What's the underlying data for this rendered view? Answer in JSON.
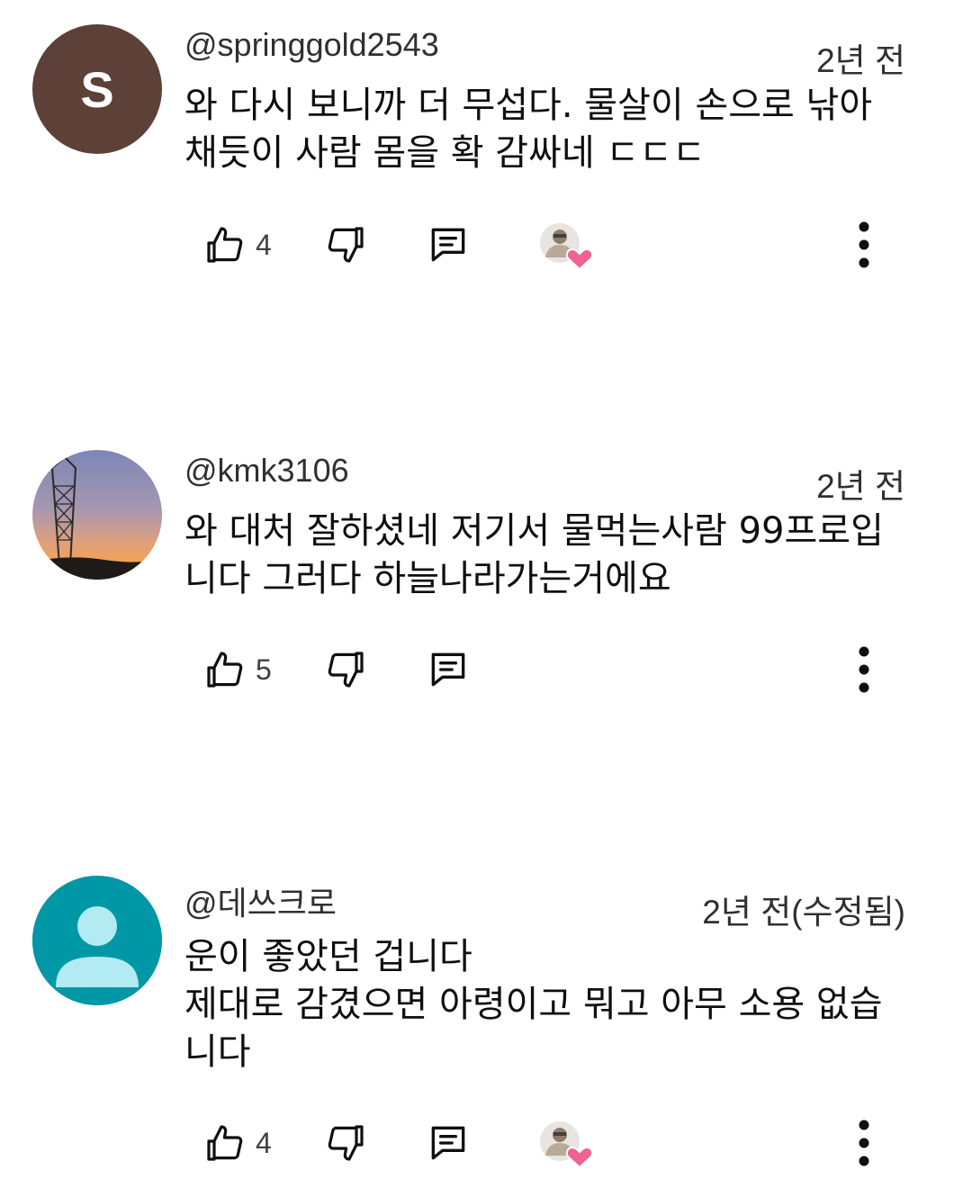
{
  "comments": [
    {
      "avatar_letter": "S",
      "avatar_color": "#5d4037",
      "handle": "@springgold2543",
      "time": "2년 전",
      "text": "와 다시 보니까 더 무섭다. 물살이 손으로 낚아\n채듯이 사람 몸을 확 감싸네 ㄷㄷㄷ",
      "likes": "4",
      "creator_heart": true
    },
    {
      "avatar_type": "sunset-photo",
      "handle": "@kmk3106",
      "time": "2년 전",
      "text": "와 대처 잘하셨네 저기서 물먹는사람 99프로입\n니다 그러다 하늘나라가는거에요",
      "likes": "5",
      "creator_heart": false
    },
    {
      "avatar_type": "default-person",
      "avatar_color": "#0097a7",
      "handle": "@데쓰크로",
      "time": "2년 전(수정됨)",
      "text": "운이 좋았던 겁니다\n제대로 감겼으면 아령이고 뭐고 아무 소용 없습\n니다",
      "likes": "4",
      "creator_heart": true
    }
  ],
  "icons": {
    "like": "thumbs-up-icon",
    "dislike": "thumbs-down-icon",
    "reply": "comment-reply-icon",
    "heart": "creator-heart-icon",
    "more": "more-vertical-icon"
  },
  "colors": {
    "heart": "#f06292",
    "text": "#0f0f0f",
    "secondary": "#303030"
  }
}
